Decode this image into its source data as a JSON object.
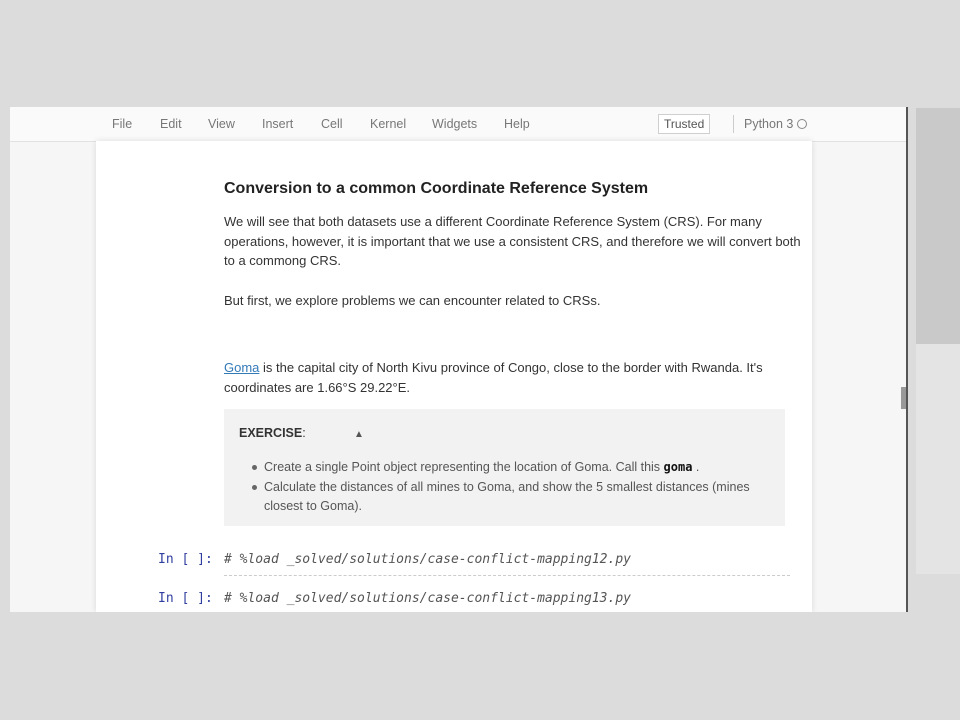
{
  "menubar": {
    "items": [
      "File",
      "Edit",
      "View",
      "Insert",
      "Cell",
      "Kernel",
      "Widgets",
      "Help"
    ],
    "trusted_label": "Trusted",
    "kernel_name": "Python 3"
  },
  "markdown": {
    "heading": "Conversion to a common Coordinate Reference System",
    "para1": "We will see that both datasets use a different Coordinate Reference System (CRS). For many operations, however, it is important that we use a consistent CRS, and therefore we will convert both to a commong CRS.",
    "para2": "But first, we explore problems we can encounter related to CRSs.",
    "goma_link": "Goma",
    "para3_rest": " is the capital city of North Kivu province of Congo, close to the border with Rwanda. It's coordinates are 1.66°S 29.22°E."
  },
  "exercise": {
    "title": "EXERCISE",
    "title_suffix": ":",
    "items": [
      {
        "before": "Create a single Point object representing the location of Goma. Call this ",
        "code": "goma",
        "after": " ."
      },
      {
        "before": "Calculate the distances of all mines to Goma, and show the 5 smallest distances (mines closest to Goma).",
        "code": "",
        "after": ""
      }
    ]
  },
  "code_cells": [
    {
      "prompt": "In [ ]:",
      "code": "# %load _solved/solutions/case-conflict-mapping12.py"
    },
    {
      "prompt": "In [ ]:",
      "code": "# %load _solved/solutions/case-conflict-mapping13.py"
    }
  ],
  "colors": {
    "link": "#337ab7",
    "prompt": "#303f9f"
  },
  "icons": {
    "kernel_status": "kernel-idle-circle-icon",
    "mouse_cursor": "cursor-arrow-icon"
  }
}
